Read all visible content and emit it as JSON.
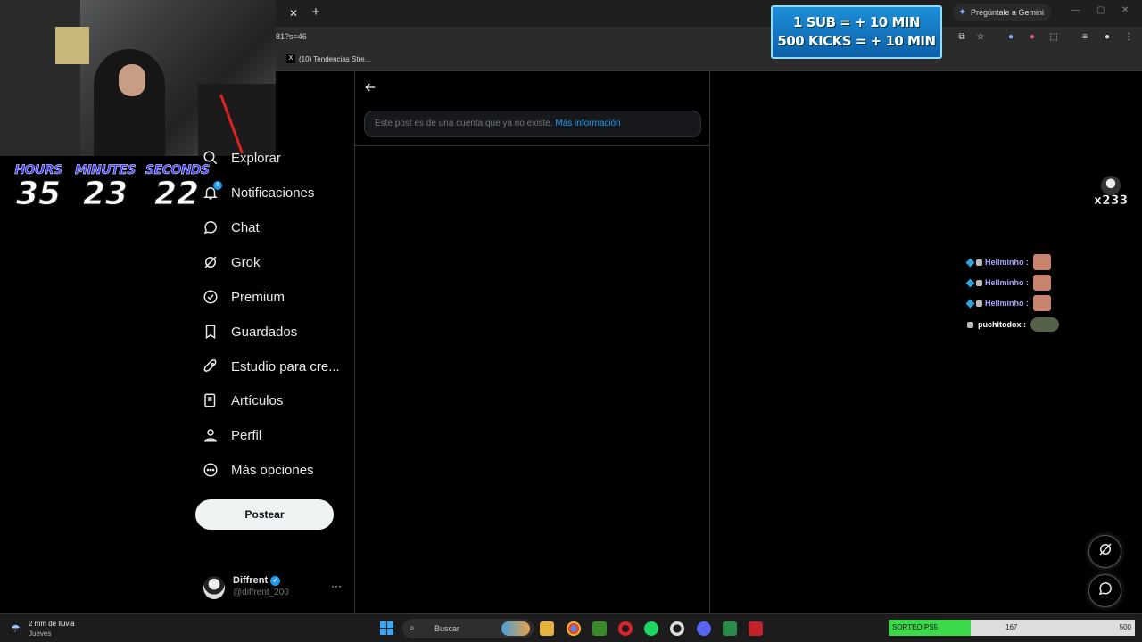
{
  "browser": {
    "url_fragment": "81?s=46",
    "bookmark_label": "(10) Tendencias Stre...",
    "gemini_label": "Pregúntale a Gemini"
  },
  "stream_overlay": {
    "sub_banner_line1": "1 SUB = + 10 MIN",
    "sub_banner_line2": "500 KICKS = + 10 MIN",
    "timer": {
      "hours_label": "HOURS",
      "hours": "35",
      "minutes_label": "MINUTES",
      "minutes": "23",
      "seconds_label": "SECONDS",
      "seconds": "22"
    },
    "combo_count": "x233",
    "chat": [
      {
        "user": "Hellminho :",
        "color": "#a9a4ff"
      },
      {
        "user": "Hellminho :",
        "color": "#a9a4ff"
      },
      {
        "user": "Hellminho :",
        "color": "#a9a4ff"
      },
      {
        "user": "puchitodox :",
        "color": "#ffffff"
      }
    ],
    "sorteo": {
      "label": "SORTEO PS5",
      "current": "167",
      "max": "500",
      "progress": 0.334
    }
  },
  "nav": {
    "items": [
      {
        "label": "Explorar",
        "icon": "search-icon"
      },
      {
        "label": "Notificaciones",
        "icon": "bell-icon",
        "badge": "8"
      },
      {
        "label": "Chat",
        "icon": "chat-icon"
      },
      {
        "label": "Grok",
        "icon": "grok-icon"
      },
      {
        "label": "Premium",
        "icon": "premium-icon"
      },
      {
        "label": "Guardados",
        "icon": "bookmark-icon"
      },
      {
        "label": "Estudio para cre...",
        "icon": "rocket-icon"
      },
      {
        "label": "Artículos",
        "icon": "article-icon"
      },
      {
        "label": "Perfil",
        "icon": "person-icon"
      },
      {
        "label": "Más opciones",
        "icon": "more-circle-icon"
      }
    ],
    "post_button": "Postear"
  },
  "profile": {
    "name": "Diffrent",
    "handle": "@diffrent_200",
    "more": "···"
  },
  "main": {
    "notice_text": "Este post es de una cuenta que ya no existe.",
    "notice_link": "Más información"
  },
  "taskbar": {
    "weather_line1": "2 mm de lluvia",
    "weather_line2": "Jueves",
    "search_placeholder": "Buscar"
  },
  "colors": {
    "accent": "#1d9bf0",
    "background": "#000000",
    "border": "#2f3336"
  }
}
